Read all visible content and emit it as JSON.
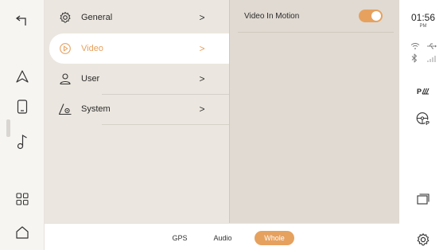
{
  "left_bar": {
    "items": [
      {
        "name": "back",
        "icon": "back-arrow-icon"
      },
      {
        "name": "navigation",
        "icon": "navigation-arrow-icon"
      },
      {
        "name": "phone",
        "icon": "phone-icon"
      },
      {
        "name": "music",
        "icon": "music-note-icon"
      },
      {
        "name": "apps",
        "icon": "apps-grid-icon"
      },
      {
        "name": "home",
        "icon": "home-icon"
      }
    ]
  },
  "menu": {
    "items": [
      {
        "label": "General",
        "icon": "gear-icon",
        "active": false
      },
      {
        "label": "Video",
        "icon": "play-circle-icon",
        "active": true
      },
      {
        "label": "User",
        "icon": "user-icon",
        "active": false
      },
      {
        "label": "System",
        "icon": "system-triangle-icon",
        "active": false
      }
    ],
    "chevron": ">"
  },
  "detail": {
    "rows": [
      {
        "label": "Video In Motion",
        "toggle_on": true
      }
    ]
  },
  "bottom_bar": {
    "tabs": [
      {
        "label": "GPS",
        "active": false
      },
      {
        "label": "Audio",
        "active": false
      },
      {
        "label": "Whole",
        "active": true
      }
    ]
  },
  "status": {
    "time": "01:56",
    "ampm": "PM",
    "parking_label": "P"
  },
  "colors": {
    "accent": "#e6a15f",
    "menu_bg": "#ebe6df",
    "detail_bg": "#e0dad2"
  }
}
